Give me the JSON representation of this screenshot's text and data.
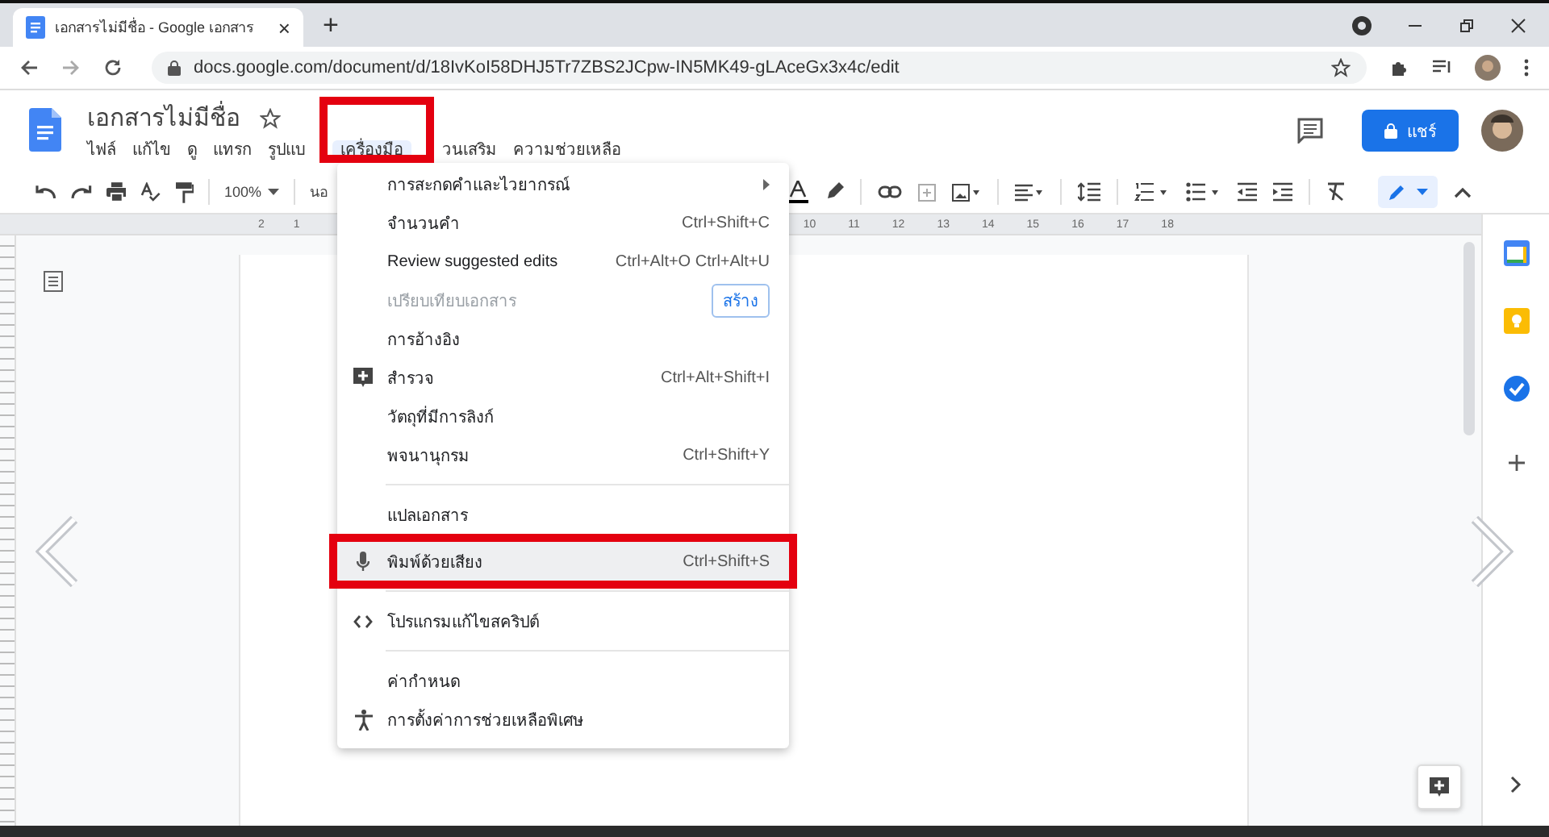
{
  "browser": {
    "tab_title": "เอกสารไม่มีชื่อ - Google เอกสาร",
    "tab_close": "×",
    "new_tab": "+",
    "url": "docs.google.com/document/d/18IvKoI58DHJ5Tr7ZBS2JCpw-IN5MK49-gLAceGx3x4c/edit"
  },
  "document": {
    "title": "เอกสารไม่มีชื่อ",
    "share_label": "แชร์"
  },
  "menubar": [
    {
      "label": "ไฟล์",
      "selected": false
    },
    {
      "label": "แก้ไข",
      "selected": false
    },
    {
      "label": "ดู",
      "selected": false
    },
    {
      "label": "แทรก",
      "selected": false
    },
    {
      "label": "รูปแบ",
      "selected": false
    },
    {
      "label": "เครื่องมือ",
      "selected": true
    },
    {
      "label": "วนเสริม",
      "selected": false
    },
    {
      "label": "ความช่วยเหลือ",
      "selected": false
    }
  ],
  "toolbar": {
    "zoom": "100%",
    "style": "นอ"
  },
  "ruler": {
    "left_labels": [
      "2",
      "1"
    ],
    "right_labels": [
      "10",
      "11",
      "12",
      "13",
      "14",
      "15",
      "16",
      "17",
      "18"
    ]
  },
  "menu": [
    {
      "kind": "item",
      "label": "การสะกดคำและไวยากรณ์",
      "submenu": true,
      "disabled": false,
      "highlighted": false
    },
    {
      "kind": "item",
      "label": "จำนวนคำ",
      "shortcut": "Ctrl+Shift+C",
      "disabled": false,
      "highlighted": false
    },
    {
      "kind": "item",
      "label": "Review suggested edits",
      "shortcut": "Ctrl+Alt+O Ctrl+Alt+U",
      "disabled": false,
      "highlighted": false
    },
    {
      "kind": "item",
      "label": "เปรียบเทียบเอกสาร",
      "button": "สร้าง",
      "disabled": true,
      "highlighted": false
    },
    {
      "kind": "item",
      "label": "การอ้างอิง",
      "disabled": false,
      "highlighted": false
    },
    {
      "kind": "item",
      "label": "สำรวจ",
      "shortcut": "Ctrl+Alt+Shift+I",
      "disabled": false,
      "highlighted": false
    },
    {
      "kind": "item",
      "label": "วัตถุที่มีการลิงก์",
      "disabled": false,
      "highlighted": false
    },
    {
      "kind": "item",
      "label": "พจนานุกรม",
      "shortcut": "Ctrl+Shift+Y",
      "disabled": false,
      "highlighted": false
    },
    {
      "kind": "divider"
    },
    {
      "kind": "item",
      "label": "แปลเอกสาร",
      "disabled": false,
      "highlighted": false
    },
    {
      "kind": "item",
      "label": "พิมพ์ด้วยเสียง",
      "shortcut": "Ctrl+Shift+S",
      "disabled": false,
      "highlighted": true
    },
    {
      "kind": "divider"
    },
    {
      "kind": "item",
      "label": "โปรแกรมแก้ไขสคริปต์",
      "disabled": false,
      "highlighted": false
    },
    {
      "kind": "divider"
    },
    {
      "kind": "item",
      "label": "ค่ากำหนด",
      "disabled": false,
      "highlighted": false
    },
    {
      "kind": "item",
      "label": "การตั้งค่าการช่วยเหลือพิเศษ",
      "disabled": false,
      "highlighted": false
    }
  ]
}
